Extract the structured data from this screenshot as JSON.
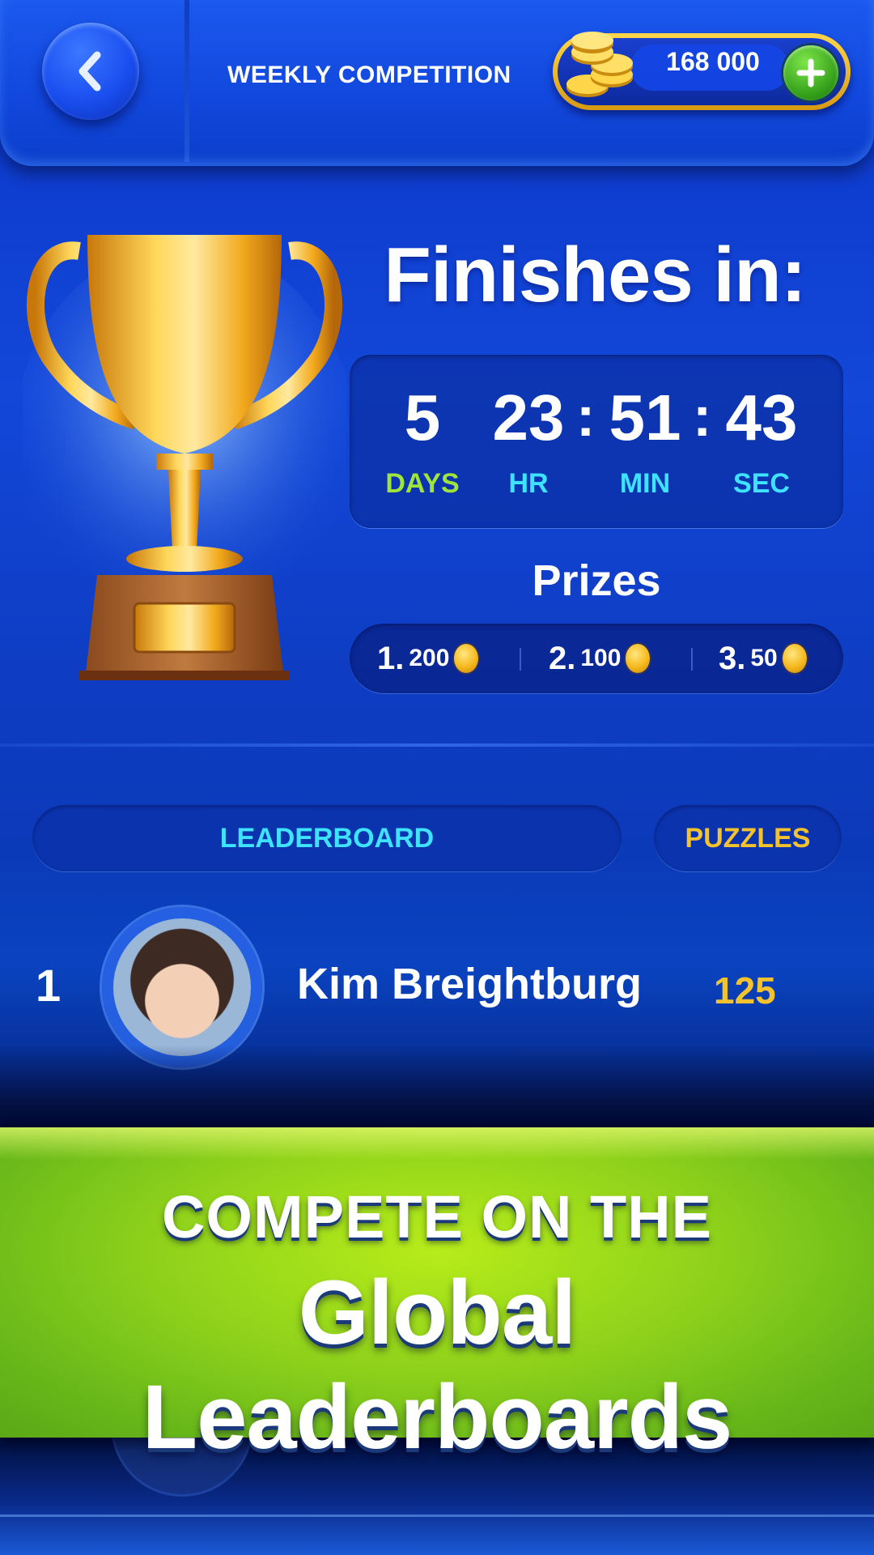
{
  "header": {
    "title": "WEEKLY COMPETITION",
    "coins": "168 000",
    "back_icon": "chevron-left-icon",
    "add_icon": "plus-icon"
  },
  "countdown": {
    "heading": "Finishes in:",
    "days": "5",
    "hours": "23",
    "minutes": "51",
    "seconds": "43",
    "separator": ":",
    "labels": {
      "days": "DAYS",
      "hours": "HR",
      "minutes": "MIN",
      "seconds": "SEC"
    }
  },
  "prizes": {
    "title": "Prizes",
    "items": [
      {
        "rank": "1.",
        "amount": "200"
      },
      {
        "rank": "2.",
        "amount": "100"
      },
      {
        "rank": "3.",
        "amount": "50"
      }
    ]
  },
  "tabs": {
    "leaderboard": "LEADERBOARD",
    "puzzles": "PUZZLES"
  },
  "leaderboard": [
    {
      "rank": "1",
      "name": "Kim Breightburg",
      "score": "125"
    }
  ],
  "banner": {
    "line1": "COMPETE ON THE",
    "line2": "Global Leaderboards"
  },
  "colors": {
    "accent_cyan": "#3ee3ff",
    "accent_gold": "#f3c22c",
    "days_green": "#9ee43a",
    "banner_green": "#8fd21b"
  }
}
